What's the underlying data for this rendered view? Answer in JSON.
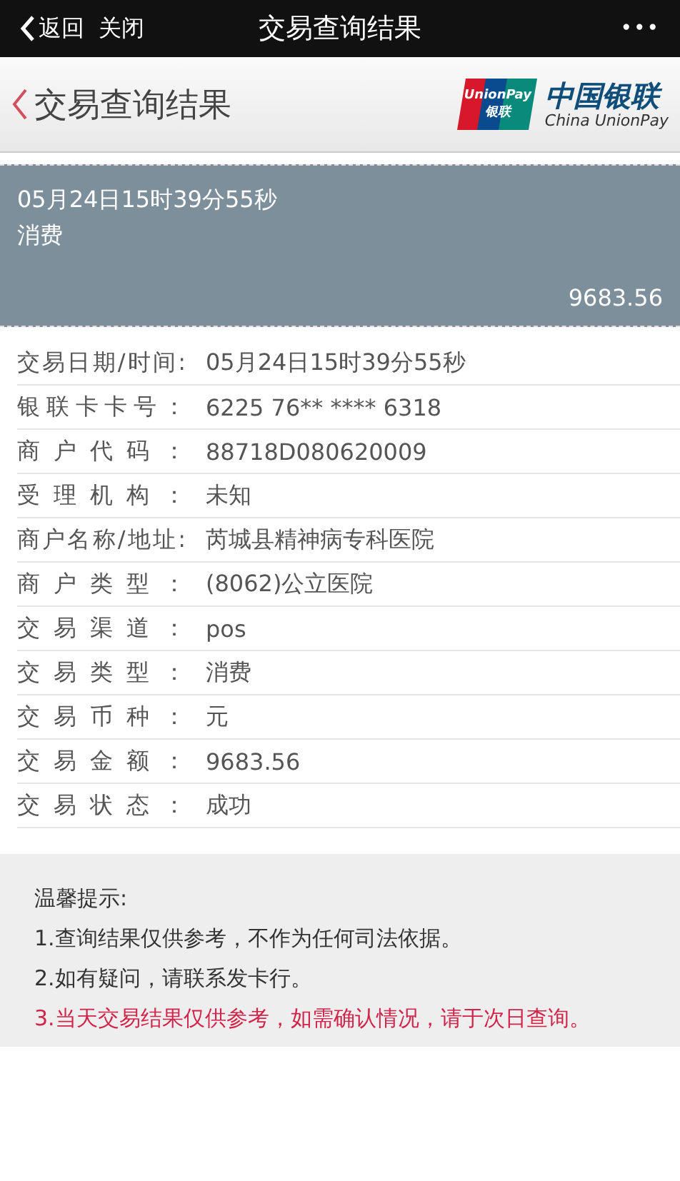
{
  "nav_bar": {
    "back": "返回",
    "close": "关闭",
    "title": "交易查询结果",
    "more": "•••"
  },
  "header": {
    "title": "交易查询结果",
    "logo_card_top": "UnionPay",
    "logo_card_bottom": "银联",
    "logo_cn": "中国银联",
    "logo_en": "China UnionPay"
  },
  "summary": {
    "datetime": "05月24日15时39分55秒",
    "type": "消费",
    "amount": "9683.56"
  },
  "details": [
    {
      "label": "交易日期/时间:",
      "value": "05月24日15时39分55秒"
    },
    {
      "label": "银联卡卡号：",
      "value": "6225 76** **** 6318"
    },
    {
      "label": "商户代码：",
      "value": "88718D080620009"
    },
    {
      "label": "受理机构：",
      "value": "未知"
    },
    {
      "label": "商户名称/地址:",
      "value": "芮城县精神病专科医院"
    },
    {
      "label": "商户类型：",
      "value": "(8062)公立医院"
    },
    {
      "label": "交易渠道：",
      "value": "pos"
    },
    {
      "label": "交易类型：",
      "value": "消费"
    },
    {
      "label": "交易币种：",
      "value": "元"
    },
    {
      "label": "交易金额：",
      "value": "9683.56"
    },
    {
      "label": "交易状态：",
      "value": "成功"
    }
  ],
  "notice": {
    "title": "温馨提示:",
    "items": [
      {
        "text": "1.查询结果仅供参考，不作为任何司法依据。",
        "kind": "normal"
      },
      {
        "text": "2.如有疑问，请联系发卡行。",
        "kind": "normal"
      },
      {
        "text": "3.当天交易结果仅供参考，如需确认情况，请于次日查询。",
        "kind": "warning"
      }
    ]
  }
}
